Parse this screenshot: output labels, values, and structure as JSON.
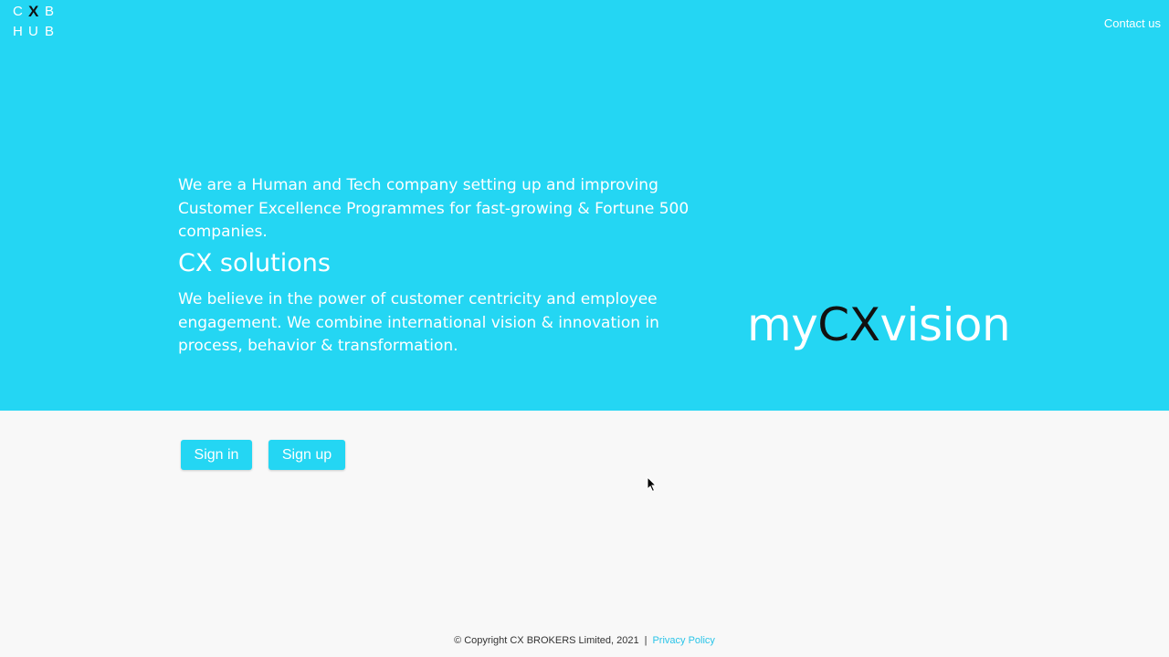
{
  "header": {
    "logo_letters": [
      "C",
      "X",
      "B",
      "H",
      "U",
      "B"
    ],
    "contact_label": "Contact us"
  },
  "hero": {
    "intro": "We are a Human and Tech company setting up and improving Customer Excellence Programmes for fast-growing & Fortune 500 companies.",
    "subtitle": "CX solutions",
    "description": "We believe in the power of customer centricity and employee engagement. We combine international vision & innovation in process, behavior & transformation.",
    "brand": {
      "prefix": "my",
      "highlight": "CX",
      "suffix": "vision"
    }
  },
  "actions": {
    "sign_in_label": "Sign in",
    "sign_up_label": "Sign up"
  },
  "footer": {
    "copyright": "© Copyright CX BROKERS Limited, 2021",
    "separator": "|",
    "privacy_label": "Privacy Policy"
  },
  "colors": {
    "accent": "#24d6f3",
    "logo_highlight": "#111111",
    "link": "#29c4e8",
    "background": "#f8f8f8"
  }
}
